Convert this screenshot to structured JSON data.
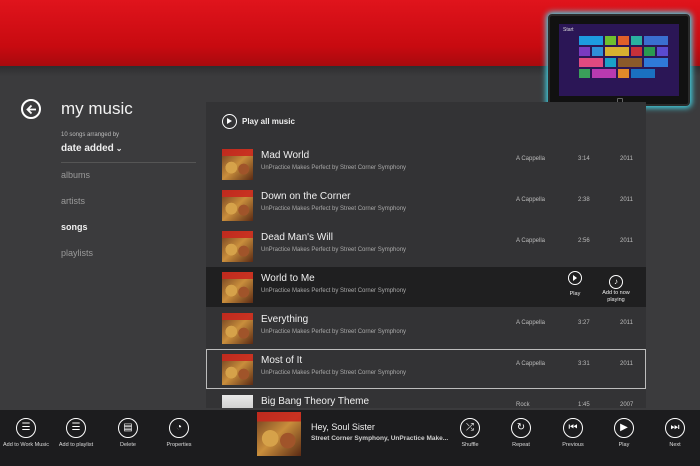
{
  "colors": {
    "accent_red": "#d4121a",
    "background": "#3b3b3d",
    "panel": "#333335",
    "appbar": "#1c1c1e",
    "tablet_glow": "#42d4e6"
  },
  "header": {
    "title": "my music",
    "sort_caption": "10 songs arranged by",
    "sort_value": "date added",
    "back_icon": "back-arrow-icon"
  },
  "nav": {
    "items": [
      {
        "label": "albums",
        "active": false
      },
      {
        "label": "artists",
        "active": false
      },
      {
        "label": "songs",
        "active": true
      },
      {
        "label": "playlists",
        "active": false
      }
    ]
  },
  "tablet": {
    "start_label": "Start"
  },
  "list": {
    "play_all_label": "Play all music",
    "songs": [
      {
        "title": "Mad World",
        "subtitle": "UnPractice Makes Perfect by Street Corner Symphony",
        "genre": "A Cappella",
        "length": "3:14",
        "year": "2011"
      },
      {
        "title": "Down on the Corner",
        "subtitle": "UnPractice Makes Perfect by Street Corner Symphony",
        "genre": "A Cappella",
        "length": "2:38",
        "year": "2011"
      },
      {
        "title": "Dead Man's Will",
        "subtitle": "UnPractice Makes Perfect by Street Corner Symphony",
        "genre": "A Cappella",
        "length": "2:56",
        "year": "2011"
      },
      {
        "title": "World to Me",
        "subtitle": "UnPractice Makes Perfect by Street Corner Symphony",
        "genre": "",
        "length": "",
        "year": ""
      },
      {
        "title": "Everything",
        "subtitle": "UnPractice Makes Perfect by Street Corner Symphony",
        "genre": "A Cappella",
        "length": "3:27",
        "year": "2011"
      },
      {
        "title": "Most of It",
        "subtitle": "UnPractice Makes Perfect by Street Corner Symphony",
        "genre": "A Cappella",
        "length": "3:31",
        "year": "2011"
      },
      {
        "title": "Big Bang Theory Theme",
        "subtitle": "",
        "genre": "Rock",
        "length": "1:45",
        "year": "2007"
      }
    ],
    "row_actions": {
      "play": "Play",
      "add_to_now_playing": "Add to now playing"
    }
  },
  "appbar": {
    "left_buttons": [
      {
        "label": "Add to Work Music",
        "icon": "add-to-list-icon"
      },
      {
        "label": "Add to playlist",
        "icon": "add-to-list-icon"
      },
      {
        "label": "Delete",
        "icon": "delete-icon"
      },
      {
        "label": "Properties",
        "icon": "properties-icon"
      }
    ],
    "now_playing": {
      "title": "Hey, Soul Sister",
      "artist": "Street Corner Symphony, UnPractice Make..."
    },
    "right_buttons": [
      {
        "label": "Shuffle",
        "icon": "shuffle-icon"
      },
      {
        "label": "Repeat",
        "icon": "repeat-icon"
      },
      {
        "label": "Previous",
        "icon": "previous-icon"
      },
      {
        "label": "Play",
        "icon": "play-icon"
      },
      {
        "label": "Next",
        "icon": "next-icon"
      }
    ]
  }
}
